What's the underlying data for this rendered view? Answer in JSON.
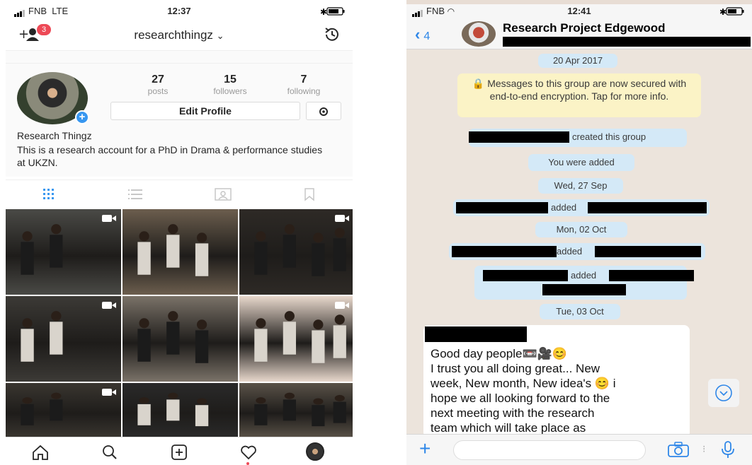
{
  "left": {
    "status": {
      "carrier": "FNB",
      "network": "LTE",
      "time": "12:37"
    },
    "header": {
      "username": "researchthingz",
      "username_caret": "⌄",
      "notification_count": "3"
    },
    "stats": [
      {
        "value": "27",
        "label": "posts"
      },
      {
        "value": "15",
        "label": "followers"
      },
      {
        "value": "7",
        "label": "following"
      }
    ],
    "edit_profile_label": "Edit Profile",
    "bio": {
      "name": "Research Thingz",
      "text": "This is a research account for a PhD in Drama & performance studies at UKZN."
    },
    "icons": {
      "tabs": [
        "grid-icon",
        "list-icon",
        "tagged-icon",
        "saved-icon"
      ],
      "bottom_nav": [
        "home-icon",
        "search-icon",
        "add-post-icon",
        "heart-icon",
        "profile-avatar"
      ]
    },
    "tiles": [
      {
        "bg": "#4a4a46",
        "video": true
      },
      {
        "bg": "#6c5e4e",
        "video": false
      },
      {
        "bg": "#2e2a26",
        "video": true
      },
      {
        "bg": "#3c3a36",
        "video": true
      },
      {
        "bg": "#7a7268",
        "video": false
      },
      {
        "bg": "#e8d8cc",
        "video": true
      },
      {
        "bg": "#3a3630",
        "video": true
      },
      {
        "bg": "#2a2a2a",
        "video": false
      },
      {
        "bg": "#5a5248",
        "video": false
      }
    ]
  },
  "right": {
    "status": {
      "carrier": "FNB",
      "time": "12:41"
    },
    "header": {
      "back_count": "4",
      "group_name": "Research Project Edgewood"
    },
    "messages": {
      "date1": "20 Apr 2017",
      "encryption_notice": "🔒 Messages to this group are now secured with end-to-end encryption. Tap for more info.",
      "created_group": "created this group",
      "you_added": "You were added",
      "date2": "Wed, 27 Sep",
      "added1": "added",
      "date3": "Mon, 02 Oct",
      "added2": "added",
      "added3": "added",
      "date4": "Tue, 03 Oct"
    },
    "incoming": {
      "lines": [
        "Good day people📼🎥😊",
        "I trust you all doing great... New",
        "week, New month,  New idea's 😊 i",
        "hope we all looking forward to the",
        "next meeting with the research",
        "team which will take place as"
      ]
    },
    "colors": {
      "accent": "#2f87e8",
      "system_bubble": "#d4e9f7",
      "notice_bubble": "#fbf3c6",
      "chat_bg": "#ece4dc"
    }
  }
}
